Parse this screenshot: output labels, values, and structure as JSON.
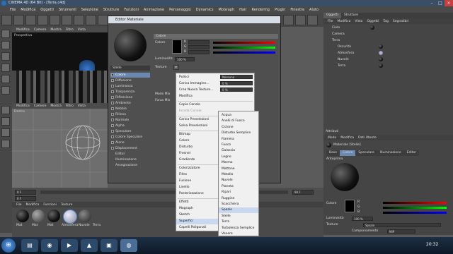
{
  "window": {
    "title": "CINEMA 4D (64 Bit) - [Terra.c4d]"
  },
  "menubar": [
    "File",
    "Modifica",
    "Oggetti",
    "Strumenti",
    "Selezione",
    "Strutture",
    "Funzioni",
    "Animazione",
    "Personaggio",
    "Dynamics",
    "MoGraph",
    "Hair",
    "Rendering",
    "Plugin",
    "Finestre",
    "Aiuto"
  ],
  "viewport_top": {
    "menu": [
      "Modifica",
      "Camere",
      "Mostra",
      "Filtro",
      "Vista"
    ],
    "label": "Prospettiva"
  },
  "viewport_bottom": {
    "menu": [
      "Modifica",
      "Camere",
      "Mostra",
      "Filtro",
      "Vista"
    ],
    "label": "Destra"
  },
  "material_manager": {
    "menu": [
      "File",
      "Modifica",
      "Funzioni",
      "Texture"
    ],
    "materials": [
      "Mat",
      "Mat",
      "Mat",
      "Atmosfera",
      "Nuvole",
      "Terra"
    ]
  },
  "objects_panel": {
    "tabs": [
      "Oggetti",
      "Strutture"
    ],
    "menu": [
      "File",
      "Modifica",
      "Vista",
      "Oggetti",
      "Tag",
      "Segnalibri"
    ],
    "items": [
      "Cielo",
      "Camera",
      "Terra",
      "Oscurità",
      "Atmosfera",
      "Nuvole",
      "Terra"
    ]
  },
  "attributes_panel": {
    "header": "Attributi",
    "menu": [
      "Modo",
      "Modifica",
      "Dati Utente"
    ],
    "name": "Materiale [Stelle]",
    "tabs": [
      "Base",
      "Colore",
      "Speculare",
      "Illuminazione",
      "Editor"
    ],
    "preview_label": "Anteprima",
    "color_label": "Colore",
    "rgb": [
      "R",
      "G",
      "B"
    ],
    "luminosity_label": "Luminosità",
    "luminosity_value": "100 %",
    "texture_label": "Texture",
    "texture_value": "Spazio",
    "sampling_label": "Campionamento",
    "sampling_value": "MIP"
  },
  "material_editor": {
    "title": "Editor Materiale",
    "section": "Colore",
    "name": "Stelle",
    "color_label": "Colore",
    "rgb": [
      "R",
      "G",
      "B"
    ],
    "luminosity_label": "Luminosità",
    "luminosity_value": "100 %",
    "texture_label": "Texture",
    "mode_label": "Modo Mix",
    "force_label": "Forza Mix",
    "channels": [
      "Colore",
      "Diffusione",
      "Luminanza",
      "Trasparenza",
      "Riflessione",
      "Ambiente",
      "Nebbia",
      "Rilievo",
      "Normale",
      "Alpha",
      "Speculare",
      "Colore Speculare",
      "Alone",
      "Displacement",
      "Editor",
      "Illuminazione",
      "Assegnazione"
    ],
    "apply_label": "Applica",
    "scale_label": "Scala"
  },
  "context_menu": {
    "items": [
      {
        "label": "Pulisci",
        "state": "normal"
      },
      {
        "label": "Carica Immagine...",
        "state": "normal"
      },
      {
        "label": "Crea Nuova Texture...",
        "state": "normal"
      },
      {
        "label": "Modifica",
        "state": "normal"
      },
      {
        "label": "Copia Canale",
        "state": "normal"
      },
      {
        "label": "Incolla Canale",
        "state": "disabled"
      },
      {
        "label": "Carica Preselezioni",
        "state": "normal"
      },
      {
        "label": "Salva Preselezioni",
        "state": "normal"
      },
      {
        "label": "Bitmap",
        "state": "sub"
      },
      {
        "label": "Colore",
        "state": "normal"
      },
      {
        "label": "Disturbo",
        "state": "normal"
      },
      {
        "label": "Fresnel",
        "state": "normal"
      },
      {
        "label": "Gradiente",
        "state": "normal"
      },
      {
        "label": "Colorizzatore",
        "state": "normal"
      },
      {
        "label": "Filtro",
        "state": "normal"
      },
      {
        "label": "Fusione",
        "state": "normal"
      },
      {
        "label": "Livello",
        "state": "normal"
      },
      {
        "label": "Posterizzazione",
        "state": "normal"
      },
      {
        "label": "Effetti",
        "state": "sub"
      },
      {
        "label": "Mograph",
        "state": "sub"
      },
      {
        "label": "Sketch",
        "state": "sub"
      },
      {
        "label": "Superfici",
        "state": "sub-hl"
      },
      {
        "label": "Capelli Poligonali",
        "state": "normal"
      }
    ],
    "option_labels": [
      "Nessuna",
      "0 %",
      "0 %"
    ]
  },
  "submenu": {
    "items": [
      "Acqua",
      "Anelli di Fuoco",
      "Ciclone",
      "Disturbo Semplice",
      "Fiamma",
      "Fuoco",
      "Galassia",
      "Legno",
      "Marmo",
      "Mattone",
      "Metallo",
      "Nuvole",
      "Pianeta",
      "Ripari",
      "Ruggine",
      "Scacchiera",
      "Spazio",
      "Stelle",
      "Terra",
      "Turbolenza Semplice",
      "Venere"
    ],
    "highlighted": "Spazio"
  },
  "timeline": {
    "frame": "0 F",
    "end": "90 F",
    "current": "0 F"
  },
  "taskbar": {
    "clock": "20:32"
  }
}
